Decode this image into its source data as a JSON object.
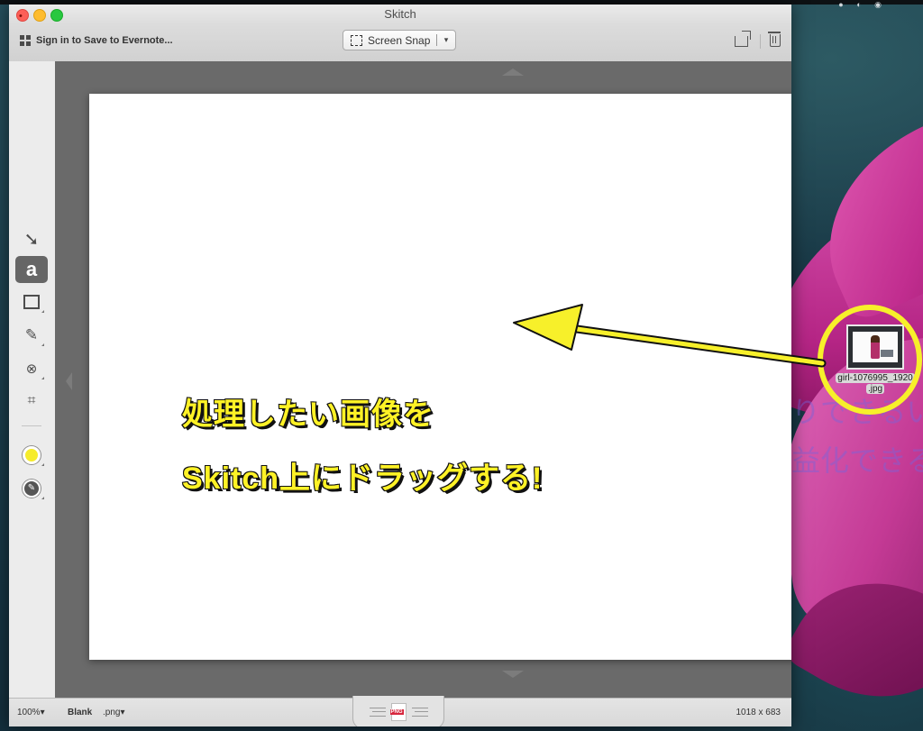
{
  "window": {
    "title": "Skitch",
    "signin_label": "Sign in to Save to Evernote...",
    "snap_label": "Screen Snap",
    "snap_caret": "▾"
  },
  "tools": {
    "arrow": "➘",
    "text": "a",
    "pen": "✎",
    "blur": "⊗",
    "crop": "⌗"
  },
  "statusbar": {
    "zoom": "100%",
    "zoom_caret": "▾",
    "name": "Blank",
    "format": ".png",
    "format_caret": "▾",
    "png_badge": "PNG",
    "dimensions": "1018 x 683"
  },
  "annotation": {
    "line1": "処理したい画像を",
    "line2": "Skitch上にドラッグする!",
    "color": "#fff226"
  },
  "desktop": {
    "file_name_line1": "girl-1076995_1920",
    "file_name_line2": ".jpg",
    "ghost_line1": "りできるい",
    "ghost_line2": "益化できる"
  },
  "colors": {
    "highlight_ring": "#f7f02a",
    "pen_color": "#f6ec2b"
  }
}
